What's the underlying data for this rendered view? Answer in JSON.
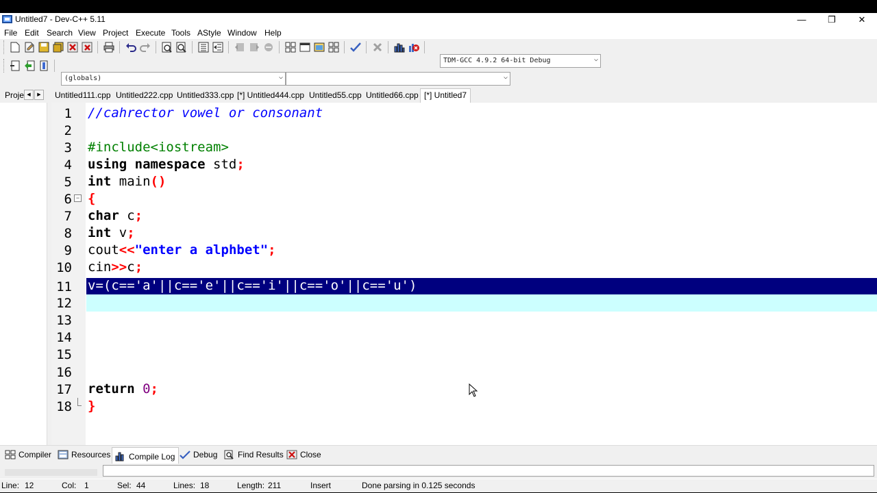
{
  "window": {
    "title": "Untitled7 - Dev-C++ 5.11",
    "minimize": "—",
    "restore": "❐",
    "close": "✕"
  },
  "menu": [
    "File",
    "Edit",
    "Search",
    "View",
    "Project",
    "Execute",
    "Tools",
    "AStyle",
    "Window",
    "Help"
  ],
  "toolbar": {
    "compiler_select": "TDM-GCC 4.9.2 64-bit Debug",
    "scope_select": "(globals)",
    "function_select": ""
  },
  "project_pane": {
    "label": "Proje"
  },
  "tabs": [
    {
      "label": "Untitled111.cpp"
    },
    {
      "label": "Untitled222.cpp"
    },
    {
      "label": "Untitled333.cpp"
    },
    {
      "label": "[*] Untitled444.cpp"
    },
    {
      "label": "Untitled55.cpp"
    },
    {
      "label": "Untitled66.cpp"
    },
    {
      "label": "[*] Untitled7"
    }
  ],
  "editor": {
    "line_numbers": [
      "1",
      "2",
      "3",
      "4",
      "5",
      "6",
      "7",
      "8",
      "9",
      "10",
      "11",
      "12",
      "13",
      "14",
      "15",
      "16",
      "17",
      "18"
    ],
    "lines": [
      "//cahrector vowel or consonant",
      "",
      "#include<iostream>",
      "using namespace std;",
      "int main()",
      "{",
      "char c;",
      "int v;",
      "cout<<\"enter a alphbet\";",
      "cin>>c;",
      "v=(c=='a'||c=='e'||c=='i'||c=='o'||c=='u')",
      "",
      "",
      "",
      "",
      "",
      "return 0;",
      "}"
    ],
    "selection_bg": "#00007f",
    "current_line_bg": "#ccffff"
  },
  "bottom_tabs": [
    {
      "label": "Compiler",
      "icon": "compiler-grid-icon"
    },
    {
      "label": "Resources",
      "icon": "resources-icon"
    },
    {
      "label": "Compile Log",
      "icon": "chart-icon"
    },
    {
      "label": "Debug",
      "icon": "check-icon"
    },
    {
      "label": "Find Results",
      "icon": "find-icon"
    },
    {
      "label": "Close",
      "icon": "close-icon"
    }
  ],
  "status": {
    "line_label": "Line:",
    "line": "12",
    "col_label": "Col:",
    "col": "1",
    "sel_label": "Sel:",
    "sel": "44",
    "lines_label": "Lines:",
    "lines": "18",
    "length_label": "Length:",
    "length": "211",
    "mode": "Insert",
    "message": "Done parsing in 0.125 seconds"
  }
}
